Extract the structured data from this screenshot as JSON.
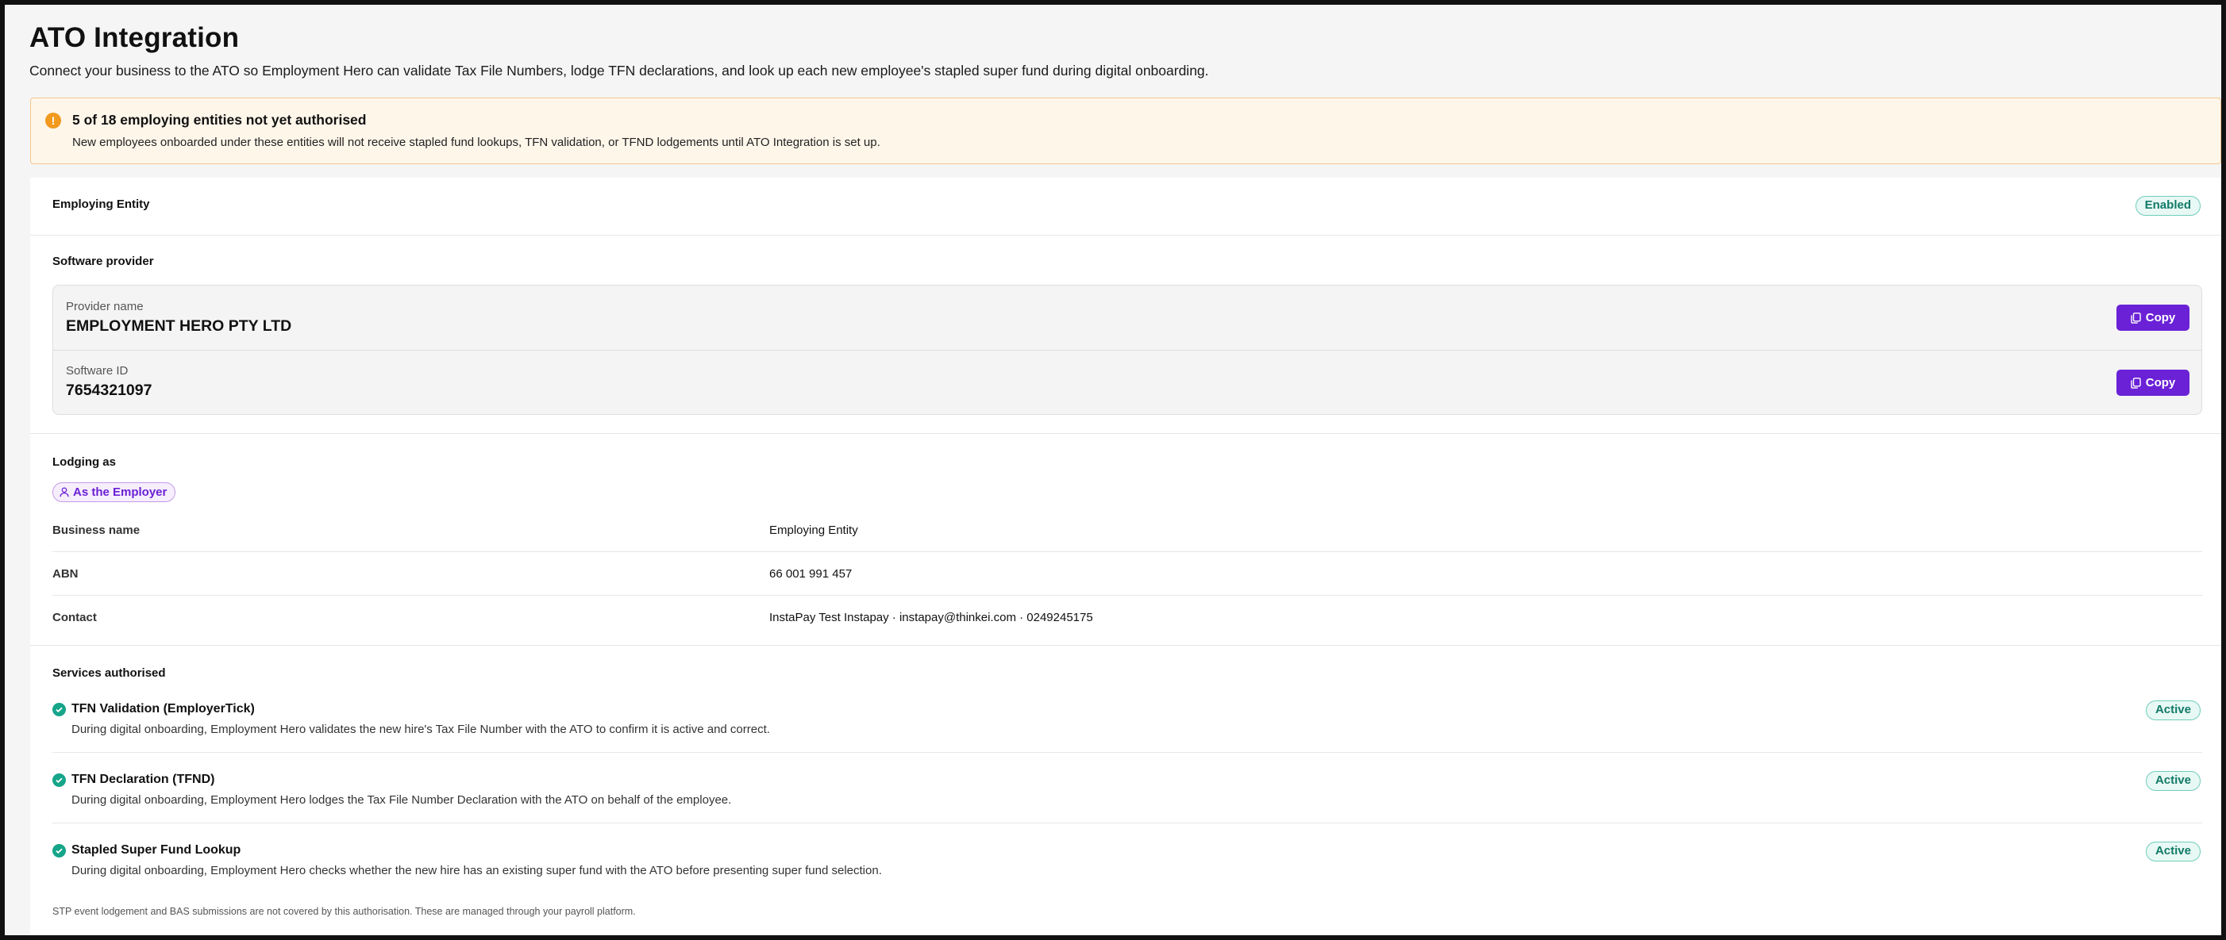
{
  "header": {
    "title": "ATO Integration",
    "subtitle": "Connect your business to the ATO so Employment Hero can validate Tax File Numbers, lodge TFN declarations, and look up each new employee's stapled super fund during digital onboarding."
  },
  "banner": {
    "icon": "!",
    "title": "5 of 18 employing entities not yet authorised",
    "text": "New employees onboarded under these entities will not receive stapled fund lookups, TFN validation, or TFND lodgements until ATO Integration is set up."
  },
  "entity": {
    "label": "Employing Entity",
    "status": "Enabled"
  },
  "software_provider": {
    "label": "Software provider",
    "provider_name_caption": "Provider name",
    "provider_name": "EMPLOYMENT HERO PTY LTD",
    "software_id_caption": "Software ID",
    "software_id": "7654321097",
    "copy_label": "Copy"
  },
  "lodging": {
    "label": "Lodging as",
    "badge": "As the Employer",
    "rows": [
      {
        "key": "Business name",
        "value": "Employing Entity"
      },
      {
        "key": "ABN",
        "value": "66 001 991 457"
      },
      {
        "key": "Contact",
        "value": "InstaPay Test Instapay · instapay@thinkei.com · 0249245175"
      }
    ]
  },
  "services": {
    "label": "Services authorised",
    "items": [
      {
        "title": "TFN Validation (EmployerTick)",
        "description": "During digital onboarding, Employment Hero validates the new hire's Tax File Number with the ATO to confirm it is active and correct.",
        "status": "Active"
      },
      {
        "title": "TFN Declaration (TFND)",
        "description": "During digital onboarding, Employment Hero lodges the Tax File Number Declaration with the ATO on behalf of the employee.",
        "status": "Active"
      },
      {
        "title": "Stapled Super Fund Lookup",
        "description": "During digital onboarding, Employment Hero checks whether the new hire has an existing super fund with the ATO before presenting super fund selection.",
        "status": "Active"
      }
    ],
    "footnote": "STP event lodgement and BAS submissions are not covered by this authorisation. These are managed through your payroll platform."
  },
  "colors": {
    "accent": "#6b21d6",
    "success": "#15a58a",
    "warning": "#f29a1e",
    "banner_bg": "#fff6ea"
  },
  "icons": {
    "banner": "warning-icon",
    "copy": "copy-icon",
    "lodging": "user-icon",
    "service": "check-circle-icon"
  }
}
